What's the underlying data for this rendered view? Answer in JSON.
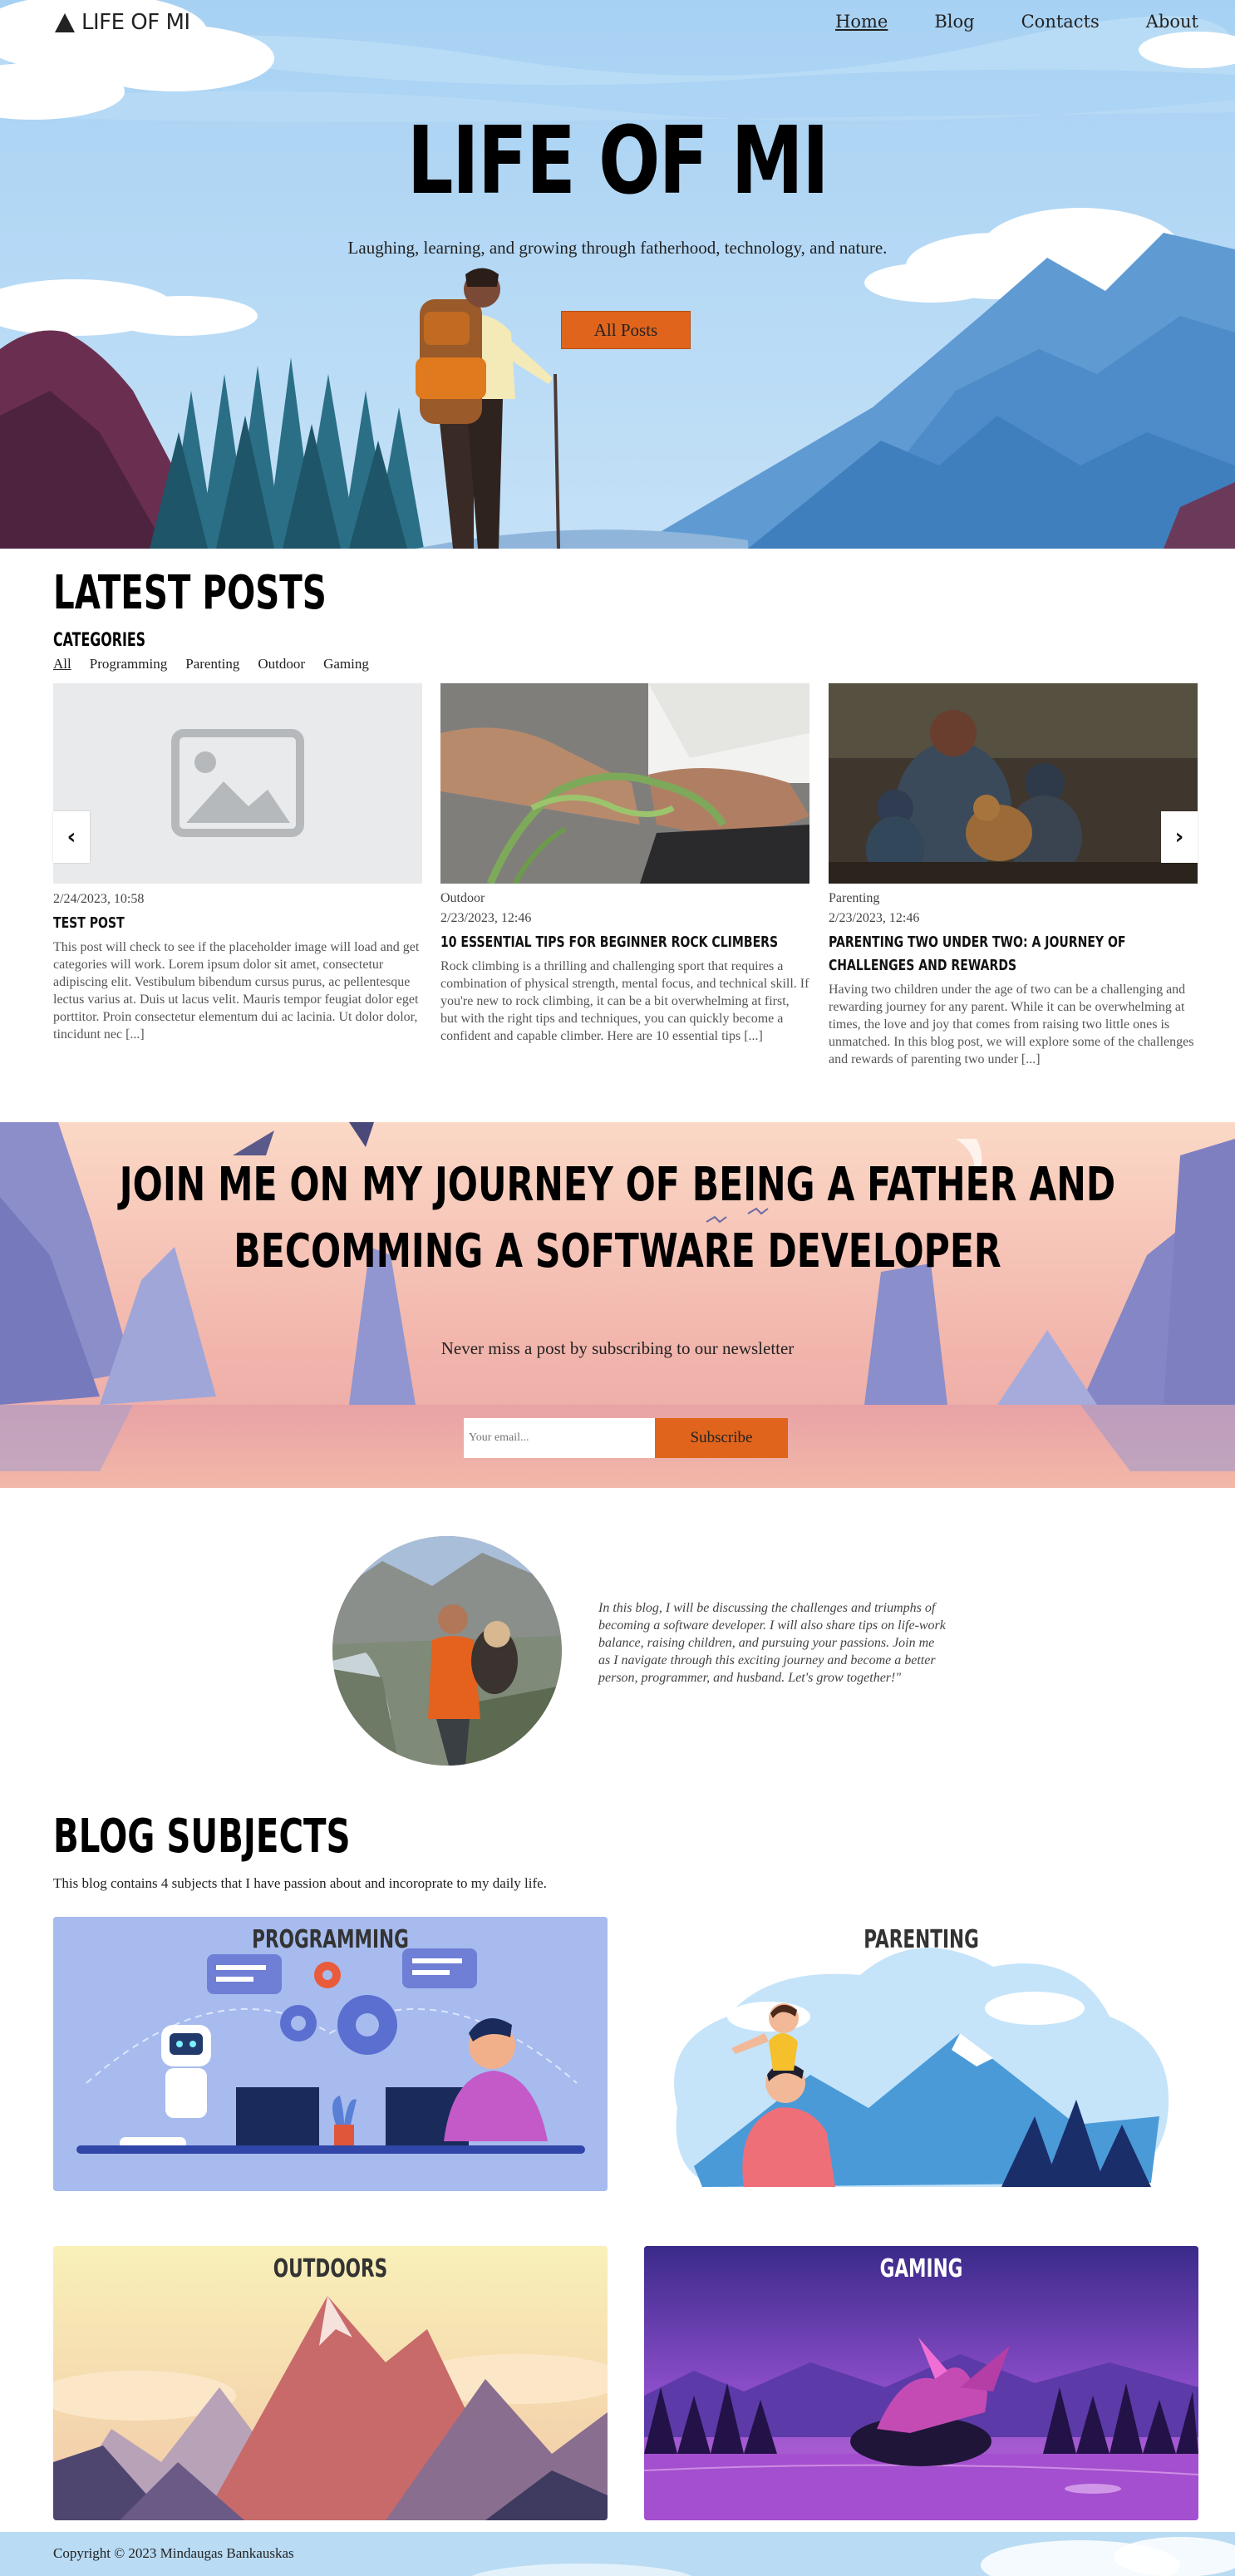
{
  "nav": {
    "logo_text": "LIFE OF MI",
    "links": [
      {
        "label": "Home",
        "active": true
      },
      {
        "label": "Blog",
        "active": false
      },
      {
        "label": "Contacts",
        "active": false
      },
      {
        "label": "About",
        "active": false
      }
    ]
  },
  "hero": {
    "title": "LIFE OF MI",
    "subtitle": "Laughing, learning, and growing through fatherhood, technology, and nature.",
    "button_label": "All Posts"
  },
  "latest": {
    "title": "LATEST POSTS",
    "categories_title": "CATEGORIES",
    "categories": [
      "All",
      "Programming",
      "Parenting",
      "Outdoor",
      "Gaming"
    ],
    "prev_icon": "chevron-left-icon",
    "next_icon": "chevron-right-icon",
    "prev_label": "‹",
    "next_label": "›",
    "posts": [
      {
        "category": "",
        "date": "2/24/2023, 10:58",
        "title": "TEST POST",
        "excerpt": "This post will check to see if the placeholder image will load and get categories will work. Lorem ipsum dolor sit amet, consectetur adipiscing elit. Vestibulum bibendum cursus purus, ac pellentesque lectus varius at. Duis ut lacus velit. Mauris tempor feugiat dolor eget porttitor. Proin consectetur elementum dui ac lacinia. Ut dolor dolor, tincidunt nec [...]",
        "image": "placeholder-image-icon"
      },
      {
        "category": "Outdoor",
        "date": "2/23/2023, 12:46",
        "title": "10 ESSENTIAL TIPS FOR BEGINNER ROCK CLIMBERS",
        "excerpt": "Rock climbing is a thrilling and challenging sport that requires a combination of physical strength, mental focus, and technical skill. If you're new to rock climbing, it can be a bit overwhelming at first, but with the right tips and techniques, you can quickly become a confident and capable climber. Here are 10 essential tips [...]",
        "image": "climbing-rope-photo"
      },
      {
        "category": "Parenting",
        "date": "2/23/2023, 12:46",
        "title": "PARENTING TWO UNDER TWO: A JOURNEY OF CHALLENGES AND REWARDS",
        "excerpt": "Having two children under the age of two can be a challenging and rewarding journey for any parent. While it can be overwhelming at times, the love and joy that comes from raising two little ones is unmatched. In this blog post, we will explore some of the challenges and rewards of parenting two under [...]",
        "image": "family-with-dog-photo"
      }
    ]
  },
  "newsletter": {
    "title": "JOIN ME ON MY JOURNEY OF BEING A FATHER AND BECOMMING A SOFTWARE DEVELOPER",
    "subtitle": "Never miss a post by subscribing to our newsletter",
    "input_placeholder": "Your email...",
    "button_label": "Subscribe"
  },
  "about": {
    "text": "In this blog, I will be discussing the challenges and triumphs of becoming a software developer. I will also share tips on life-work balance, raising children, and pursuing your passions. Join me as I navigate through this exciting journey and become a better person, programmer, and husband. Let's grow together!\""
  },
  "subjects": {
    "title": "BLOG SUBJECTS",
    "description": "This blog contains 4 subjects that I have passion about and incoroprate to my daily life.",
    "items": [
      {
        "label": "PROGRAMMING"
      },
      {
        "label": "PARENTING"
      },
      {
        "label": "OUTDOORS"
      },
      {
        "label": "GAMING"
      }
    ]
  },
  "footer": {
    "copyright": "Copyright © 2023 Mindaugas Bankauskas"
  },
  "colors": {
    "accent": "#e0641c",
    "sky": "#a9d3f3",
    "footer_bg": "#b9dbf3"
  }
}
